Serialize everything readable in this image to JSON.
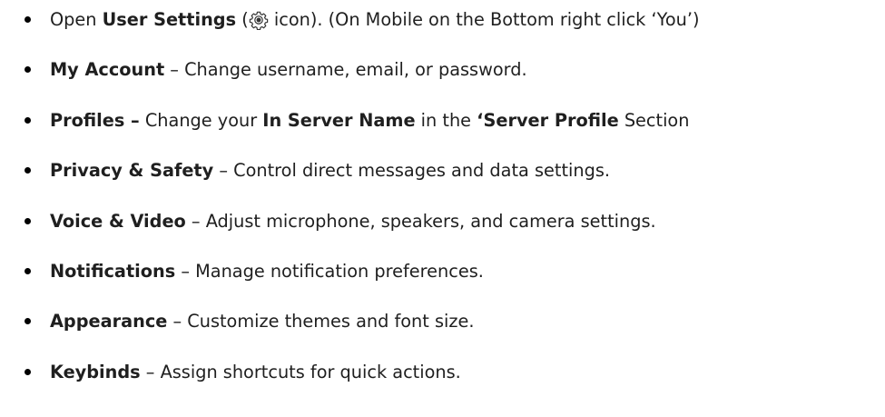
{
  "items": [
    {
      "parts": [
        {
          "text": "Open ",
          "bold": false
        },
        {
          "text": "User Settings",
          "bold": true
        },
        {
          "text": " (",
          "bold": false
        },
        {
          "icon": "gear-icon"
        },
        {
          "text": " icon). (On Mobile on the Bottom right click ‘You’)",
          "bold": false
        }
      ]
    },
    {
      "parts": [
        {
          "text": "My Account",
          "bold": true
        },
        {
          "text": " – Change username, email, or password.",
          "bold": false
        }
      ]
    },
    {
      "parts": [
        {
          "text": "Profiles –",
          "bold": true
        },
        {
          "text": " Change your ",
          "bold": false
        },
        {
          "text": "In Server Name",
          "bold": true
        },
        {
          "text": " in the ",
          "bold": false
        },
        {
          "text": "‘Server Profile",
          "bold": true
        },
        {
          "text": " Section",
          "bold": false
        }
      ]
    },
    {
      "parts": [
        {
          "text": "Privacy & Safety",
          "bold": true
        },
        {
          "text": " – Control direct messages and data settings.",
          "bold": false
        }
      ]
    },
    {
      "parts": [
        {
          "text": "Voice & Video",
          "bold": true
        },
        {
          "text": " – Adjust microphone, speakers, and camera settings.",
          "bold": false
        }
      ]
    },
    {
      "parts": [
        {
          "text": "Notifications",
          "bold": true
        },
        {
          "text": " – Manage notification preferences.",
          "bold": false
        }
      ]
    },
    {
      "parts": [
        {
          "text": "Appearance",
          "bold": true
        },
        {
          "text": " – Customize themes and font size.",
          "bold": false
        }
      ]
    },
    {
      "parts": [
        {
          "text": "Keybinds",
          "bold": true
        },
        {
          "text": " – Assign shortcuts for quick actions.",
          "bold": false
        }
      ]
    }
  ]
}
